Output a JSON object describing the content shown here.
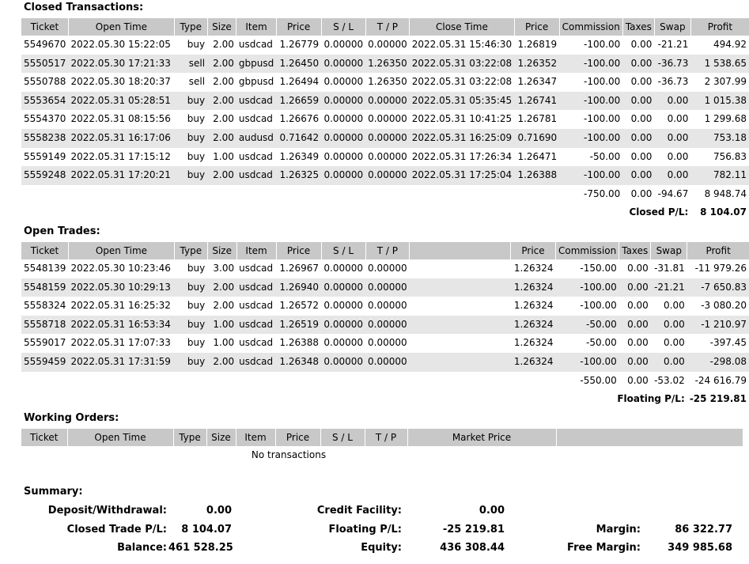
{
  "closed": {
    "title": "Closed Transactions:",
    "headers": [
      "Ticket",
      "Open Time",
      "Type",
      "Size",
      "Item",
      "Price",
      "S / L",
      "T / P",
      "Close Time",
      "Price",
      "Commission",
      "Taxes",
      "Swap",
      "Profit"
    ],
    "rows": [
      [
        "5549670",
        "2022.05.30 15:22:05",
        "buy",
        "2.00",
        "usdcad",
        "1.26779",
        "0.00000",
        "0.00000",
        "2022.05.31 15:46:30",
        "1.26819",
        "-100.00",
        "0.00",
        "-21.21",
        "494.92"
      ],
      [
        "5550517",
        "2022.05.30 17:21:33",
        "sell",
        "2.00",
        "gbpusd",
        "1.26450",
        "0.00000",
        "1.26350",
        "2022.05.31 03:22:08",
        "1.26352",
        "-100.00",
        "0.00",
        "-36.73",
        "1 538.65"
      ],
      [
        "5550788",
        "2022.05.30 18:20:37",
        "sell",
        "2.00",
        "gbpusd",
        "1.26494",
        "0.00000",
        "1.26350",
        "2022.05.31 03:22:08",
        "1.26347",
        "-100.00",
        "0.00",
        "-36.73",
        "2 307.99"
      ],
      [
        "5553654",
        "2022.05.31 05:28:51",
        "buy",
        "2.00",
        "usdcad",
        "1.26659",
        "0.00000",
        "0.00000",
        "2022.05.31 05:35:45",
        "1.26741",
        "-100.00",
        "0.00",
        "0.00",
        "1 015.38"
      ],
      [
        "5554370",
        "2022.05.31 08:15:56",
        "buy",
        "2.00",
        "usdcad",
        "1.26676",
        "0.00000",
        "0.00000",
        "2022.05.31 10:41:25",
        "1.26781",
        "-100.00",
        "0.00",
        "0.00",
        "1 299.68"
      ],
      [
        "5558238",
        "2022.05.31 16:17:06",
        "buy",
        "2.00",
        "audusd",
        "0.71642",
        "0.00000",
        "0.00000",
        "2022.05.31 16:25:09",
        "0.71690",
        "-100.00",
        "0.00",
        "0.00",
        "753.18"
      ],
      [
        "5559149",
        "2022.05.31 17:15:12",
        "buy",
        "1.00",
        "usdcad",
        "1.26349",
        "0.00000",
        "0.00000",
        "2022.05.31 17:26:34",
        "1.26471",
        "-50.00",
        "0.00",
        "0.00",
        "756.83"
      ],
      [
        "5559248",
        "2022.05.31 17:20:21",
        "buy",
        "2.00",
        "usdcad",
        "1.26325",
        "0.00000",
        "0.00000",
        "2022.05.31 17:25:04",
        "1.26388",
        "-100.00",
        "0.00",
        "0.00",
        "782.11"
      ]
    ],
    "totals": {
      "commission": "-750.00",
      "taxes": "0.00",
      "swap": "-94.67",
      "profit": "8 948.74"
    },
    "pl_label": "Closed P/L:",
    "pl_value": "8 104.07"
  },
  "open": {
    "title": "Open Trades:",
    "headers": [
      "Ticket",
      "Open Time",
      "Type",
      "Size",
      "Item",
      "Price",
      "S / L",
      "T / P",
      "",
      "Price",
      "Commission",
      "Taxes",
      "Swap",
      "Profit"
    ],
    "rows": [
      [
        "5548139",
        "2022.05.30 10:23:46",
        "buy",
        "3.00",
        "usdcad",
        "1.26967",
        "0.00000",
        "0.00000",
        "",
        "1.26324",
        "-150.00",
        "0.00",
        "-31.81",
        "-11 979.26"
      ],
      [
        "5548159",
        "2022.05.30 10:29:13",
        "buy",
        "2.00",
        "usdcad",
        "1.26940",
        "0.00000",
        "0.00000",
        "",
        "1.26324",
        "-100.00",
        "0.00",
        "-21.21",
        "-7 650.83"
      ],
      [
        "5558324",
        "2022.05.31 16:25:32",
        "buy",
        "2.00",
        "usdcad",
        "1.26572",
        "0.00000",
        "0.00000",
        "",
        "1.26324",
        "-100.00",
        "0.00",
        "0.00",
        "-3 080.20"
      ],
      [
        "5558718",
        "2022.05.31 16:53:34",
        "buy",
        "1.00",
        "usdcad",
        "1.26519",
        "0.00000",
        "0.00000",
        "",
        "1.26324",
        "-50.00",
        "0.00",
        "0.00",
        "-1 210.97"
      ],
      [
        "5559017",
        "2022.05.31 17:07:33",
        "buy",
        "1.00",
        "usdcad",
        "1.26388",
        "0.00000",
        "0.00000",
        "",
        "1.26324",
        "-50.00",
        "0.00",
        "0.00",
        "-397.45"
      ],
      [
        "5559459",
        "2022.05.31 17:31:59",
        "buy",
        "2.00",
        "usdcad",
        "1.26348",
        "0.00000",
        "0.00000",
        "",
        "1.26324",
        "-100.00",
        "0.00",
        "0.00",
        "-298.08"
      ]
    ],
    "totals": {
      "commission": "-550.00",
      "taxes": "0.00",
      "swap": "-53.02",
      "profit": "-24 616.79"
    },
    "pl_label": "Floating P/L:",
    "pl_value": "-25 219.81"
  },
  "working": {
    "title": "Working Orders:",
    "headers": [
      "Ticket",
      "Open Time",
      "Type",
      "Size",
      "Item",
      "Price",
      "S / L",
      "T / P",
      "Market Price",
      ""
    ],
    "empty": "No transactions"
  },
  "summary": {
    "title": "Summary:",
    "deposit_label": "Deposit/Withdrawal:",
    "deposit_value": "0.00",
    "closed_label": "Closed Trade P/L:",
    "closed_value": "8 104.07",
    "balance_label": "Balance:",
    "balance_value": "461 528.25",
    "credit_label": "Credit Facility:",
    "credit_value": "0.00",
    "floating_label": "Floating P/L:",
    "floating_value": "-25 219.81",
    "equity_label": "Equity:",
    "equity_value": "436 308.44",
    "margin_label": "Margin:",
    "margin_value": "86 322.77",
    "free_margin_label": "Free Margin:",
    "free_margin_value": "349 985.68"
  }
}
